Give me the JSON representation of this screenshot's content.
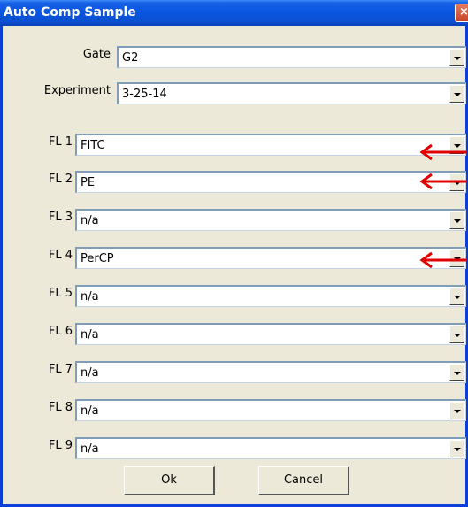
{
  "window": {
    "title": "Auto Comp Sample",
    "close_glyph": "×"
  },
  "gate": {
    "label": "Gate",
    "value": "G2"
  },
  "experiment": {
    "label": "Experiment",
    "value": "3-25-14"
  },
  "channels": [
    {
      "label": "FL 1",
      "value": "FITC",
      "highlighted": true
    },
    {
      "label": "FL 2",
      "value": "PE",
      "highlighted": true
    },
    {
      "label": "FL 3",
      "value": "n/a",
      "highlighted": false
    },
    {
      "label": "FL 4",
      "value": "PerCP",
      "highlighted": true
    },
    {
      "label": "FL 5",
      "value": "n/a",
      "highlighted": false
    },
    {
      "label": "FL 6",
      "value": "n/a",
      "highlighted": false
    },
    {
      "label": "FL 7",
      "value": "n/a",
      "highlighted": false
    },
    {
      "label": "FL 8",
      "value": "n/a",
      "highlighted": false
    },
    {
      "label": "FL 9",
      "value": "n/a",
      "highlighted": false
    }
  ],
  "buttons": {
    "ok": "Ok",
    "cancel": "Cancel"
  },
  "colors": {
    "titlebar": "#0a55e0",
    "window_bg": "#ece9d8",
    "annotation_arrow": "#e00000"
  }
}
